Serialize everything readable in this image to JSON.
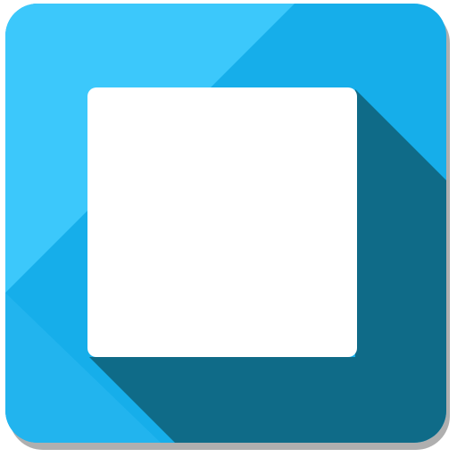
{
  "icon": {
    "name": "stop-square-icon",
    "colors": {
      "base": "#16AEEA",
      "light": "#3CC8FB",
      "shadow": "#0F6B88",
      "square": "#FFFFFF",
      "drop_shadow": "#6E6E6E"
    }
  }
}
